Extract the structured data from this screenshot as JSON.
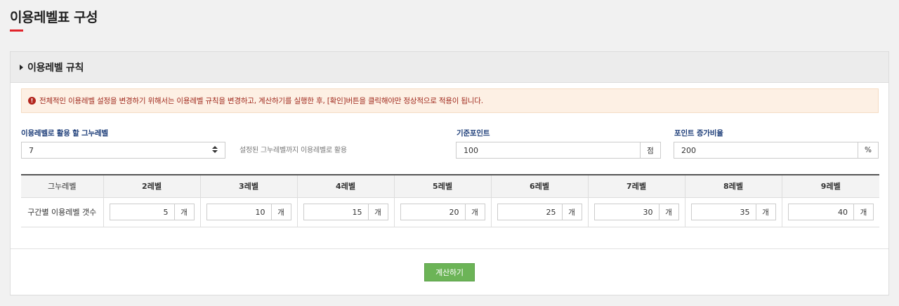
{
  "page": {
    "title": "이용레벨표 구성"
  },
  "panel": {
    "title": "이용레벨 규칙",
    "notice": "전체적인 이용레벨 설정을 변경하기 위해서는 이용레벨 규칙을 변경하고, 계산하기를 실행한 후, [확인]버튼을 클릭해야만 정상적으로 적용이 됩니다."
  },
  "form": {
    "group_level": {
      "label": "이용레벨로 활용 할 그누레벨",
      "value": "7",
      "hint": "설정된 그누레벨까지 이용레벨로 활용"
    },
    "base_point": {
      "label": "기준포인트",
      "value": "100",
      "unit": "점"
    },
    "increase_rate": {
      "label": "포인트 증가비율",
      "value": "200",
      "unit": "%"
    }
  },
  "table": {
    "headers": [
      "그누레벨",
      "2레벨",
      "3레벨",
      "4레벨",
      "5레벨",
      "6레벨",
      "7레벨",
      "8레벨",
      "9레벨"
    ],
    "row_label": "구간별 이용레벨 갯수",
    "unit": "개",
    "values": [
      "5",
      "10",
      "15",
      "20",
      "25",
      "30",
      "35",
      "40"
    ]
  },
  "actions": {
    "calculate": "계산하기"
  },
  "colors": {
    "accent": "#e1242b",
    "button": "#6cb457",
    "label": "#1f3f7a",
    "notice_text": "#a02a1e"
  }
}
